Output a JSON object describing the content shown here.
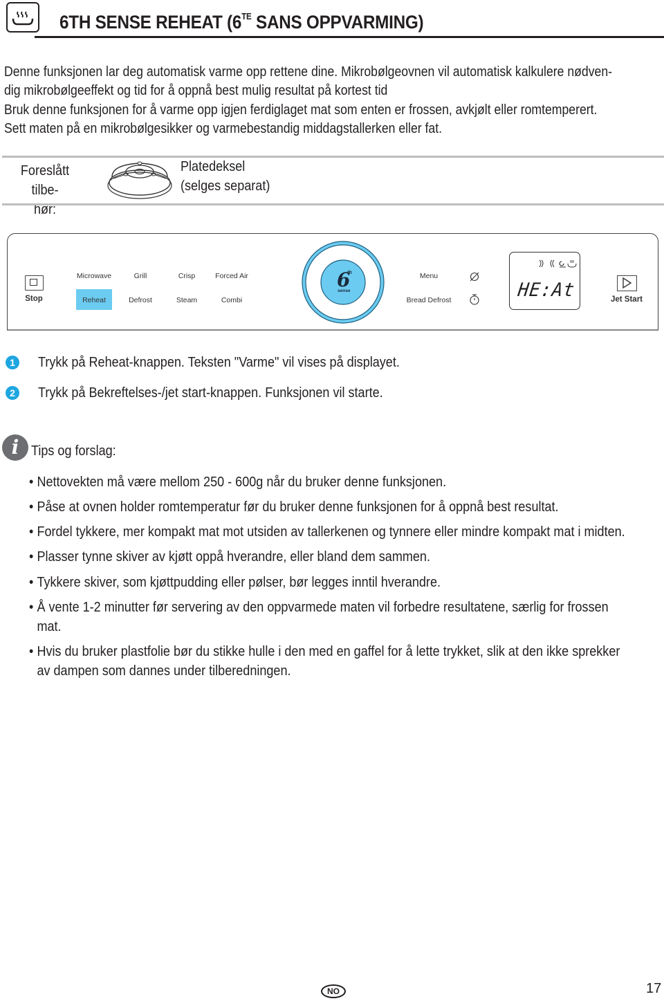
{
  "header": {
    "icon": "reheat-plate-steam-icon",
    "title_main": "6TH SENSE REHEAT (6",
    "title_sup": "TE",
    "title_rest": " SANS OPPVARMING)"
  },
  "intro": {
    "lines": [
      "Denne funksjonen lar deg automatisk varme opp rettene dine. Mikrobølgeovnen vil automatisk kalkulere nødven-",
      "dig mikrobølgeeffekt og tid for å oppnå best mulig resultat på kortest tid",
      "Bruk denne funksjonen for å varme opp igjen ferdiglaget mat som enten er frossen, avkjølt eller romtemperert.",
      "Sett maten på en mikrobølgesikker og varmebestandig middagstallerken eller fat."
    ]
  },
  "accessory": {
    "label_line1": "Foreslått tilbe-",
    "label_line2": "hør:",
    "icon": "plate-cover-icon",
    "name_line1": "Platedeksel",
    "name_line2": "(selges separat)"
  },
  "panel": {
    "stop_label": "Stop",
    "buttons_top": [
      "Microwave",
      "Grill",
      "Crisp",
      "Forced Air"
    ],
    "buttons_bottom": [
      "Reheat",
      "Defrost",
      "Steam",
      "Combi"
    ],
    "highlighted": "Reheat",
    "dial_label_big": "6",
    "dial_label_sup": "th",
    "dial_label_small": "sense",
    "menu_label": "Menu",
    "bread_defrost_label": "Bread Defrost",
    "display_text": "HE:At",
    "jet_start_label": "Jet Start",
    "accent_color": "#6ccbf0"
  },
  "steps": [
    {
      "num": "1",
      "text": "Trykk på Reheat-knappen. Teksten \"Varme\" vil vises på displayet."
    },
    {
      "num": "2",
      "text": "Trykk på Bekreftelses-/jet start-knappen. Funksjonen vil starte."
    }
  ],
  "tips": {
    "title": "Tips og forslag:",
    "items": [
      {
        "line1": "Nettovekten må være mellom 250 - 600g når du bruker denne funksjonen."
      },
      {
        "line1": "Påse at ovnen holder romtemperatur før du bruker denne funksjonen for å oppnå best resultat."
      },
      {
        "line1": "Fordel tykkere, mer kompakt mat mot utsiden av tallerkenen og tynnere eller mindre kompakt mat i midten."
      },
      {
        "line1": "Plasser tynne skiver av kjøtt oppå hverandre, eller bland dem sammen."
      },
      {
        "line1": "Tykkere skiver, som kjøttpudding eller pølser, bør legges inntil hverandre."
      },
      {
        "line1": "Å vente 1-2 minutter før servering av den oppvarmede maten vil forbedre resultatene, særlig for frossen",
        "line2": "mat."
      },
      {
        "line1": "Hvis du bruker plastfolie bør du stikke hulle i den med en gaffel for å lette trykket, slik at den ikke sprekker",
        "line2": "av dampen som dannes under tilberedningen."
      }
    ]
  },
  "footer": {
    "language_badge": "NO",
    "page_number": "17"
  }
}
